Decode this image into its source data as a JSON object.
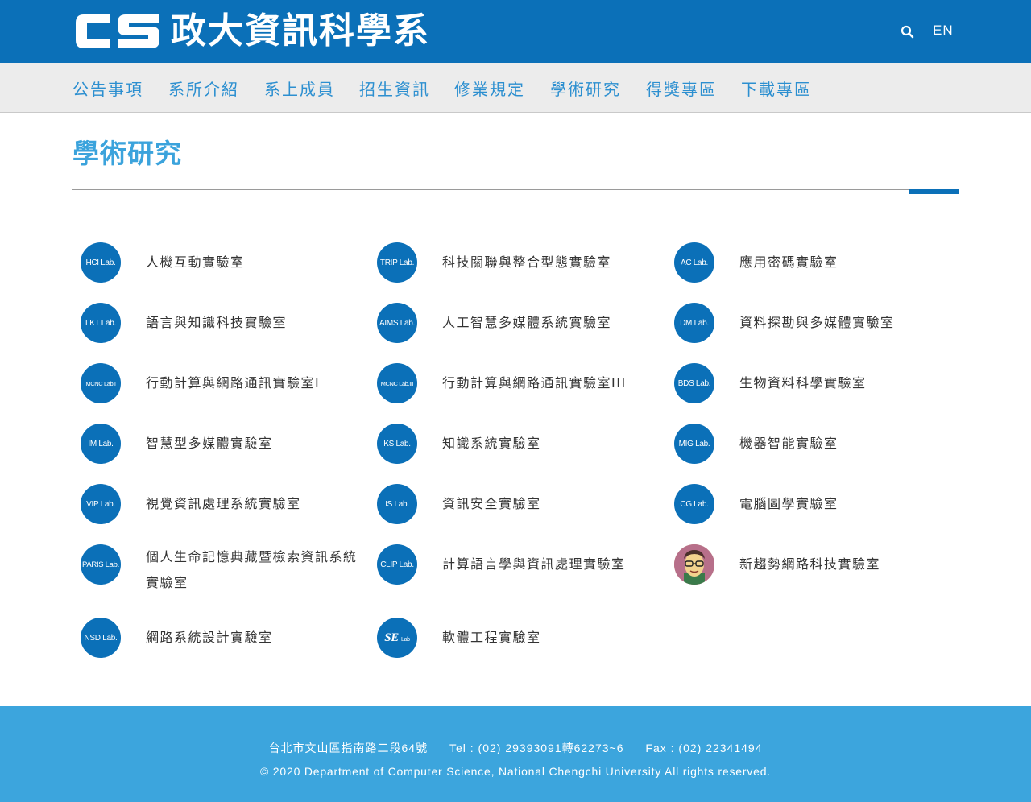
{
  "header": {
    "logo_mark": "CS",
    "logo_text": "政大資訊科學系",
    "lang": "EN",
    "search_icon": "search-icon"
  },
  "nav": {
    "items": [
      "公告事項",
      "系所介紹",
      "系上成員",
      "招生資訊",
      "修業規定",
      "學術研究",
      "得獎專區",
      "下載專區"
    ]
  },
  "page": {
    "title": "學術研究"
  },
  "labs": [
    {
      "badge": "HCI Lab.",
      "name": "人機互動實驗室"
    },
    {
      "badge": "TRIP Lab.",
      "name": "科技關聯與整合型態實驗室"
    },
    {
      "badge": "AC Lab.",
      "name": "應用密碼實驗室"
    },
    {
      "badge": "LKT Lab.",
      "name": "語言與知識科技實驗室"
    },
    {
      "badge": "AIMS Lab.",
      "name": "人工智慧多媒體系統實驗室"
    },
    {
      "badge": "DM Lab.",
      "name": "資料探勘與多媒體實驗室"
    },
    {
      "badge": "MCNC Lab.I",
      "name": "行動計算與網路通訊實驗室I"
    },
    {
      "badge": "MCNC Lab.III",
      "name": "行動計算與網路通訊實驗室III"
    },
    {
      "badge": "BDS Lab.",
      "name": "生物資料科學實驗室"
    },
    {
      "badge": "IM Lab.",
      "name": "智慧型多媒體實驗室"
    },
    {
      "badge": "KS Lab.",
      "name": "知識系統實驗室"
    },
    {
      "badge": "MIG Lab.",
      "name": "機器智能實驗室"
    },
    {
      "badge": "VIP Lab.",
      "name": "視覺資訊處理系統實驗室"
    },
    {
      "badge": "IS Lab.",
      "name": "資訊安全實驗室"
    },
    {
      "badge": "CG Lab.",
      "name": "電腦圖學實驗室"
    },
    {
      "badge": "PARIS Lab.",
      "name": "個人生命記憶典藏暨檢索資訊系統實驗室"
    },
    {
      "badge": "CLIP Lab.",
      "name": "計算語言學與資訊處理實驗室"
    },
    {
      "badge": "",
      "icon": "professor-avatar-icon",
      "name": "新趨勢網路科技實驗室"
    },
    {
      "badge": "NSD Lab.",
      "name": "網路系統設計實驗室"
    },
    {
      "badge_mark": "SE",
      "badge_sub": "Lab",
      "name": "軟體工程實驗室"
    }
  ],
  "footer": {
    "address": "台北市文山區指南路二段64號",
    "tel": "Tel : (02) 29393091轉62273~6",
    "fax": "Fax : (02) 22341494",
    "copyright": "© 2020 Department of Computer Science, National Chengchi University All rights reserved."
  },
  "colors": {
    "header_blue": "#0b70b8",
    "nav_text": "#2c8fd0",
    "title_blue": "#3ba3dc",
    "footer_blue": "#3ca5dd"
  }
}
